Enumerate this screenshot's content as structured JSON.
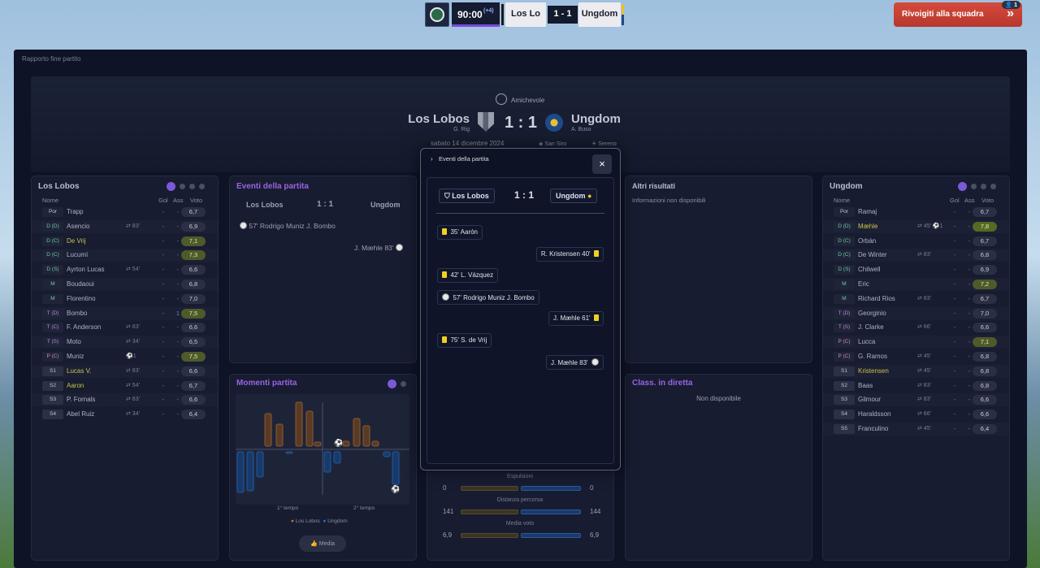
{
  "scoreboard": {
    "time": "90:00",
    "added": "(+4)",
    "home": "Los Lo",
    "score": "1 - 1",
    "away": "Ungdom"
  },
  "return_button": {
    "label": "Rivoigiti alla squadra",
    "badge": "1"
  },
  "report_label": "Rapporto fine partito",
  "header": {
    "competition": "Amichevole",
    "home": "Los Lobos",
    "home_manager": "G. Rig",
    "score": "1 : 1",
    "away": "Ungdom",
    "away_manager": "A. Buso",
    "date": "sabato 14 dicembre 2024",
    "venue": "San Siro",
    "weather": "Sereno"
  },
  "columns": {
    "name": "Nome",
    "gol": "Gol",
    "ass": "Ass",
    "voto": "Voto"
  },
  "home_team": {
    "title": "Los Lobos",
    "players": [
      {
        "pos": "Por",
        "cls": "",
        "name": "Trapp",
        "hl": false,
        "sub": "",
        "gol": "-",
        "ass": "-",
        "voto": "6,7",
        "vc": ""
      },
      {
        "pos": "D (D)",
        "cls": "d",
        "name": "Asencio",
        "hl": false,
        "sub": "⇄ 83'",
        "gol": "-",
        "ass": "-",
        "voto": "6,9",
        "vc": ""
      },
      {
        "pos": "D (C)",
        "cls": "d",
        "name": "De Vrij",
        "hl": true,
        "sub": "",
        "gol": "-",
        "ass": "-",
        "voto": "7,1",
        "vc": "g"
      },
      {
        "pos": "D (C)",
        "cls": "d",
        "name": "Lucumí",
        "hl": false,
        "sub": "",
        "gol": "-",
        "ass": "-",
        "voto": "7,3",
        "vc": "g"
      },
      {
        "pos": "D (S)",
        "cls": "d",
        "name": "Ayrton Lucas",
        "hl": false,
        "sub": "⇄ 54'",
        "gol": "-",
        "ass": "-",
        "voto": "6,6",
        "vc": ""
      },
      {
        "pos": "M",
        "cls": "m",
        "name": "Boudaoui",
        "hl": false,
        "sub": "",
        "gol": "-",
        "ass": "-",
        "voto": "6,8",
        "vc": ""
      },
      {
        "pos": "M",
        "cls": "m",
        "name": "Florentino",
        "hl": false,
        "sub": "",
        "gol": "-",
        "ass": "-",
        "voto": "7,0",
        "vc": ""
      },
      {
        "pos": "T (D)",
        "cls": "t",
        "name": "Bombo",
        "hl": false,
        "sub": "",
        "gol": "-",
        "ass": "1",
        "voto": "7,5",
        "vc": "g"
      },
      {
        "pos": "T (C)",
        "cls": "t",
        "name": "F. Anderson",
        "hl": false,
        "sub": "⇄ 83'",
        "gol": "-",
        "ass": "-",
        "voto": "6,6",
        "vc": ""
      },
      {
        "pos": "T (S)",
        "cls": "t",
        "name": "Moto",
        "hl": false,
        "sub": "⇄ 34'",
        "gol": "-",
        "ass": "-",
        "voto": "6,5",
        "vc": ""
      },
      {
        "pos": "P (C)",
        "cls": "p",
        "name": "Muniz",
        "hl": false,
        "sub": "⚽1",
        "gol": "-",
        "ass": "-",
        "voto": "7,5",
        "vc": "g"
      },
      {
        "pos": "S1",
        "cls": "s",
        "name": "Lucas V.",
        "hl": true,
        "sub": "⇄ 83'",
        "gol": "-",
        "ass": "-",
        "voto": "6,6",
        "vc": ""
      },
      {
        "pos": "S2",
        "cls": "s",
        "name": "Aaron",
        "hl": true,
        "sub": "⇄ 54'",
        "gol": "-",
        "ass": "-",
        "voto": "6,7",
        "vc": ""
      },
      {
        "pos": "S3",
        "cls": "s",
        "name": "P. Fornals",
        "hl": false,
        "sub": "⇄ 83'",
        "gol": "-",
        "ass": "-",
        "voto": "6,6",
        "vc": ""
      },
      {
        "pos": "S4",
        "cls": "s",
        "name": "Abel Ruiz",
        "hl": false,
        "sub": "⇄ 34'",
        "gol": "-",
        "ass": "-",
        "voto": "6,4",
        "vc": ""
      }
    ]
  },
  "away_team": {
    "title": "Ungdom",
    "players": [
      {
        "pos": "Por",
        "cls": "",
        "name": "Ramaj",
        "hl": false,
        "sub": "",
        "gol": "-",
        "ass": "-",
        "voto": "6,7",
        "vc": ""
      },
      {
        "pos": "D (D)",
        "cls": "d",
        "name": "Mæhle",
        "hl": true,
        "sub": "⇄ 45'  ⚽1",
        "gol": "-",
        "ass": "-",
        "voto": "7,8",
        "vc": "gg"
      },
      {
        "pos": "D (C)",
        "cls": "d",
        "name": "Orbán",
        "hl": false,
        "sub": "",
        "gol": "-",
        "ass": "-",
        "voto": "6,7",
        "vc": ""
      },
      {
        "pos": "D (C)",
        "cls": "d",
        "name": "De Winter",
        "hl": false,
        "sub": "⇄ 83'",
        "gol": "-",
        "ass": "-",
        "voto": "6,8",
        "vc": ""
      },
      {
        "pos": "D (S)",
        "cls": "d",
        "name": "Chilwell",
        "hl": false,
        "sub": "",
        "gol": "-",
        "ass": "-",
        "voto": "6,9",
        "vc": ""
      },
      {
        "pos": "M",
        "cls": "m",
        "name": "Eric",
        "hl": false,
        "sub": "",
        "gol": "-",
        "ass": "-",
        "voto": "7,2",
        "vc": "g"
      },
      {
        "pos": "M",
        "cls": "m",
        "name": "Richard Rios",
        "hl": false,
        "sub": "⇄ 83'",
        "gol": "-",
        "ass": "-",
        "voto": "6,7",
        "vc": ""
      },
      {
        "pos": "T (D)",
        "cls": "t",
        "name": "Georginio",
        "hl": false,
        "sub": "",
        "gol": "-",
        "ass": "-",
        "voto": "7,0",
        "vc": ""
      },
      {
        "pos": "T (S)",
        "cls": "t",
        "name": "J. Clarke",
        "hl": false,
        "sub": "⇄ 66'",
        "gol": "-",
        "ass": "-",
        "voto": "6,6",
        "vc": ""
      },
      {
        "pos": "P (C)",
        "cls": "p",
        "name": "Lucca",
        "hl": false,
        "sub": "",
        "gol": "-",
        "ass": "-",
        "voto": "7,1",
        "vc": "g"
      },
      {
        "pos": "P (C)",
        "cls": "p",
        "name": "G. Ramos",
        "hl": false,
        "sub": "⇄ 45'",
        "gol": "-",
        "ass": "-",
        "voto": "6,8",
        "vc": ""
      },
      {
        "pos": "S1",
        "cls": "s",
        "name": "Kristensen",
        "hl": true,
        "sub": "⇄ 45'",
        "gol": "-",
        "ass": "-",
        "voto": "6,8",
        "vc": ""
      },
      {
        "pos": "S2",
        "cls": "s",
        "name": "Baas",
        "hl": false,
        "sub": "⇄ 83'",
        "gol": "-",
        "ass": "-",
        "voto": "6,8",
        "vc": ""
      },
      {
        "pos": "S3",
        "cls": "s",
        "name": "Gilmour",
        "hl": false,
        "sub": "⇄ 83'",
        "gol": "-",
        "ass": "-",
        "voto": "6,6",
        "vc": ""
      },
      {
        "pos": "S4",
        "cls": "s",
        "name": "Haraldsson",
        "hl": false,
        "sub": "⇄ 66'",
        "gol": "-",
        "ass": "-",
        "voto": "6,6",
        "vc": ""
      },
      {
        "pos": "S5",
        "cls": "s",
        "name": "Franculino",
        "hl": false,
        "sub": "⇄ 45'",
        "gol": "-",
        "ass": "-",
        "voto": "6,4",
        "vc": ""
      }
    ]
  },
  "events_panel": {
    "title": "Eventi della partita",
    "home": "Los Lobos",
    "score": "1 : 1",
    "away": "Ungdom",
    "line1": "57'  Rodrigo Muniz  J. Bombo",
    "line2": "J. Mæhle  83'"
  },
  "moments": {
    "title": "Momenti partita",
    "first_half": "1° tempo",
    "second_half": "2° tempo",
    "legend_home": "Los Lobos",
    "legend_away": "Ungdom",
    "media_button": "Media",
    "colors": {
      "home": "#8a5a30",
      "away": "#1f5aa0"
    }
  },
  "other_results": {
    "title": "Altri risultati",
    "text": "Informazioni non disponibili"
  },
  "live_table": {
    "title": "Class. in diretta",
    "text": "Non disponibile"
  },
  "stats": [
    {
      "label": "Espulsioni",
      "home": "0",
      "away": "0"
    },
    {
      "label": "Distanza percorsa",
      "home": "141",
      "away": "144"
    },
    {
      "label": "Media voto",
      "home": "6,9",
      "away": "6,9"
    }
  ],
  "modal": {
    "title": "Eventi della partita",
    "close": "×",
    "home": "Los Lobos",
    "score": "1 : 1",
    "away": "Ungdom",
    "events": [
      {
        "side": "home",
        "type": "card",
        "text": "35'  Aarón"
      },
      {
        "side": "away",
        "type": "card",
        "text": "R. Kristensen  40'"
      },
      {
        "side": "home",
        "type": "card",
        "text": "42'  L. Vázquez"
      },
      {
        "side": "home",
        "type": "goal",
        "text": "57'  Rodrigo Muniz  J. Bombo"
      },
      {
        "side": "away",
        "type": "card",
        "text": "J. Mæhle  61'"
      },
      {
        "side": "home",
        "type": "card",
        "text": "75'  S. de Vrij"
      },
      {
        "side": "away",
        "type": "goal",
        "text": "J. Mæhle  83'"
      }
    ]
  }
}
